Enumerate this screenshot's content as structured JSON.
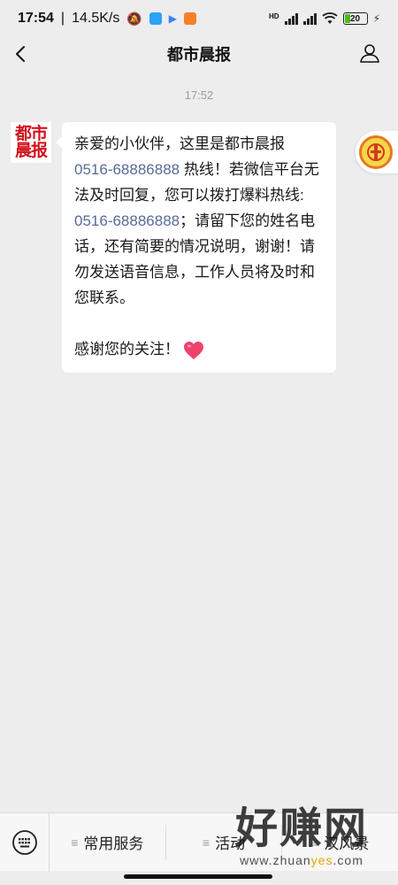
{
  "status_bar": {
    "time": "17:54",
    "speed": "14.5K/s",
    "network_label": "HD",
    "battery": "20"
  },
  "nav": {
    "title": "都市晨报"
  },
  "chat": {
    "timestamp": "17:52",
    "avatar_line1": "都市",
    "avatar_line2": "晨报",
    "message": {
      "p1_a": "亲爱的小伙伴，这里是都市晨报",
      "p1_phone1": "0516-68886888",
      "p1_b": " 热线！若微信平台无法及时回复，您可以拨打爆料热线: ",
      "p1_phone2": "0516-68886888",
      "p1_c": "；请留下您的姓名电话，还有简要的情况说明，谢谢！请勿发送语音信息，工作人员将及时和您联系。",
      "p2": "感谢您的关注！"
    }
  },
  "bottom_menu": {
    "item1": "常用服务",
    "item2": "活动",
    "item3": "汉风景"
  },
  "watermark": {
    "big": "好赚网",
    "small_a": "www.zhuan",
    "small_hl": "yes",
    "small_b": ".com"
  },
  "colors": {
    "link": "#576b95",
    "brand_red": "#d0121b",
    "background": "#ededed"
  }
}
